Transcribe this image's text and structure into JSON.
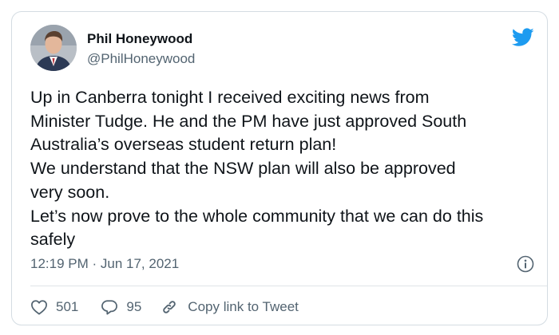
{
  "tweet": {
    "author_name": "Phil Honeywood",
    "author_handle": "@PhilHoneywood",
    "text_lines": [
      "Up in Canberra tonight I received exciting news from",
      "Minister Tudge. He and the PM have just approved South",
      "Australia’s overseas student return plan!",
      "We understand that the NSW plan will also be approved",
      "very soon.",
      "Let’s now prove to the whole community that we can do this",
      "safely"
    ],
    "timestamp": "12:19 PM · Jun 17, 2021"
  },
  "actions": {
    "like_count": "501",
    "reply_count": "95",
    "copy_link_label": "Copy link to Tweet"
  },
  "icons": {
    "brand": "twitter-bird-icon",
    "info": "info-icon",
    "like": "heart-icon",
    "reply": "reply-bubble-icon",
    "link": "link-icon"
  },
  "colors": {
    "brand_blue": "#1d9bf0",
    "text_primary": "#0f1419",
    "text_secondary": "#536471",
    "border": "#d4dce2"
  }
}
